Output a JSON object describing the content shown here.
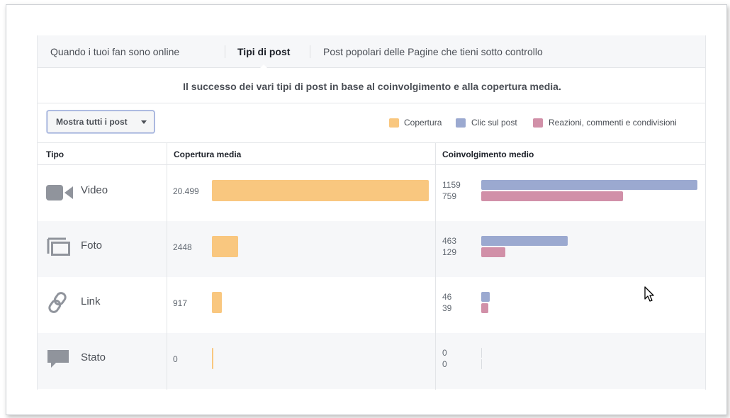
{
  "tabs": [
    {
      "label": "Quando i tuoi fan sono online",
      "active": false
    },
    {
      "label": "Tipi di post",
      "active": true
    },
    {
      "label": "Post popolari delle Pagine che tieni sotto controllo",
      "active": false
    }
  ],
  "subtitle": "Il successo dei vari tipi di post in base al coinvolgimento e alla copertura media.",
  "filter": {
    "label": "Mostra tutti i post"
  },
  "legend": [
    {
      "label": "Copertura",
      "color": "#f9c77f"
    },
    {
      "label": "Clic sul post",
      "color": "#9ba9d0"
    },
    {
      "label": "Reazioni, commenti e condivisioni",
      "color": "#d190a8"
    }
  ],
  "table": {
    "headers": {
      "type": "Tipo",
      "reach": "Copertura media",
      "engagement": "Coinvolgimento medio"
    },
    "rows": [
      {
        "icon": "video-camera-icon",
        "type": "Video",
        "reach": "20.499",
        "reach_value": 20499,
        "clicks": "1159",
        "clicks_value": 1159,
        "reactions": "759",
        "reactions_value": 759
      },
      {
        "icon": "photo-icon",
        "type": "Foto",
        "reach": "2448",
        "reach_value": 2448,
        "clicks": "463",
        "clicks_value": 463,
        "reactions": "129",
        "reactions_value": 129
      },
      {
        "icon": "link-icon",
        "type": "Link",
        "reach": "917",
        "reach_value": 917,
        "clicks": "46",
        "clicks_value": 46,
        "reactions": "39",
        "reactions_value": 39
      },
      {
        "icon": "status-speech-bubble-icon",
        "type": "Stato",
        "reach": "0",
        "reach_value": 0,
        "clicks": "0",
        "clicks_value": 0,
        "reactions": "0",
        "reactions_value": 0
      }
    ]
  },
  "colors": {
    "reach": "#f9c77f",
    "clicks": "#9ba9d0",
    "reactions": "#d190a8",
    "icon": "#90949c"
  }
}
